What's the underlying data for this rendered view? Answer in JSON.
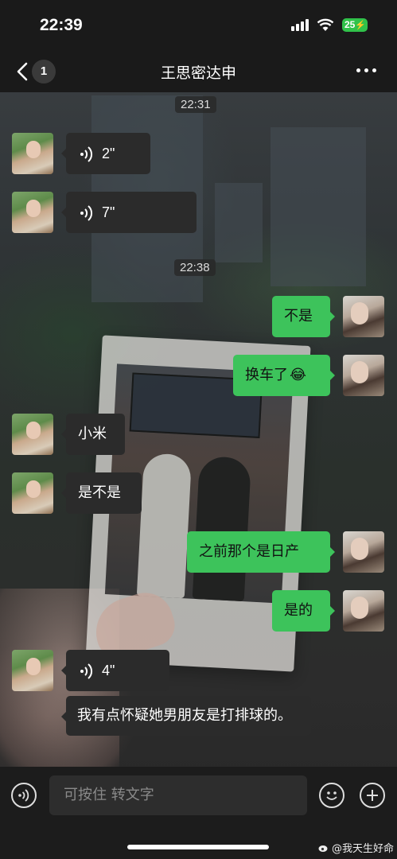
{
  "status_bar": {
    "time": "22:39",
    "battery": "25"
  },
  "nav": {
    "unread_count": "1",
    "title": "王思密达申"
  },
  "messages": [
    {
      "type": "timestamp",
      "text": "22:31"
    },
    {
      "type": "voice",
      "side": "left",
      "duration": "2\""
    },
    {
      "type": "voice",
      "side": "left",
      "duration": "7\""
    },
    {
      "type": "timestamp",
      "text": "22:38"
    },
    {
      "type": "text",
      "side": "right",
      "text": "不是"
    },
    {
      "type": "text",
      "side": "right",
      "text": "换车了",
      "emoji": "😂"
    },
    {
      "type": "text",
      "side": "left",
      "text": "小米"
    },
    {
      "type": "text",
      "side": "left",
      "text": "是不是"
    },
    {
      "type": "text",
      "side": "right",
      "text": "之前那个是日产"
    },
    {
      "type": "text",
      "side": "right",
      "text": "是的"
    },
    {
      "type": "voice",
      "side": "left",
      "duration": "4\""
    },
    {
      "type": "text",
      "side": "left",
      "text": "我有点怀疑她男朋友是打排球的。"
    }
  ],
  "input": {
    "placeholder": "可按住 转文字"
  },
  "watermark": {
    "text": "@我天生好命"
  },
  "colors": {
    "outgoing_bubble": "#3dc35b",
    "incoming_bubble": "#2b2b2b",
    "battery": "#30c24a"
  }
}
